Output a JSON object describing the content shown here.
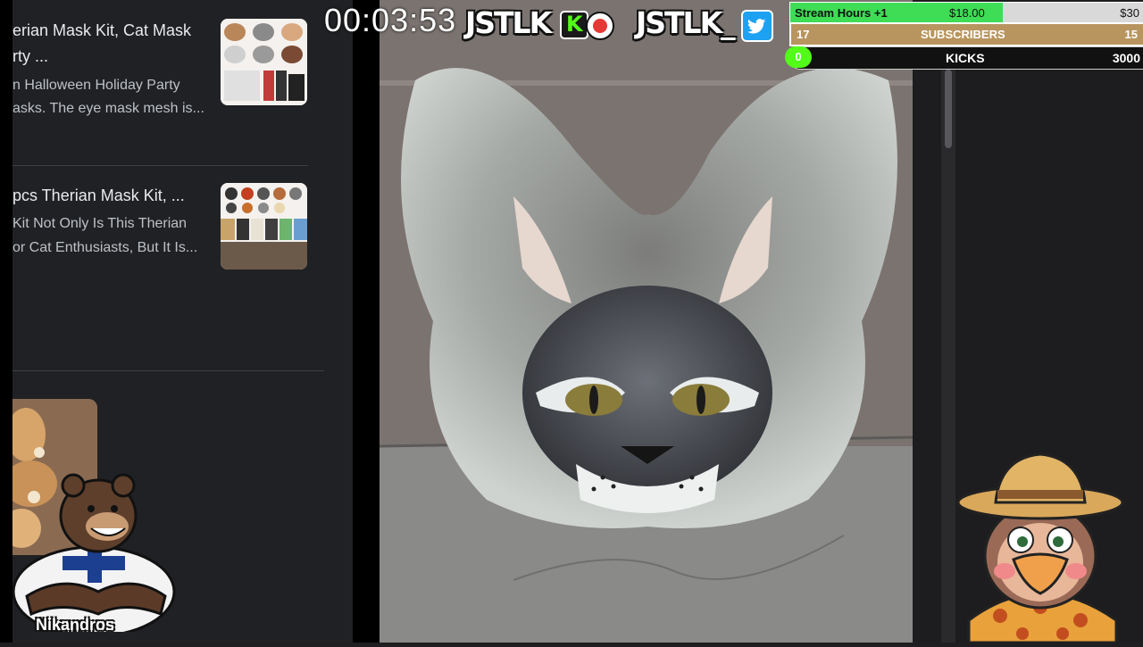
{
  "search_results": [
    {
      "title_line1": "erian Mask Kit, Cat Mask",
      "title_line2": "rty ...",
      "desc_line1": "n Halloween Holiday Party",
      "desc_line2": "asks. The eye mask mesh is..."
    },
    {
      "title_line1": "pcs Therian Mask Kit, ...",
      "desc_line1": "Kit Not Only Is This Therian",
      "desc_line2": "or Cat Enthusiasts, But It Is..."
    }
  ],
  "overlay": {
    "timer": "00:03:53",
    "kick_handle": "JSTLK",
    "kick_letter": "K",
    "twitter_handle": "JSTLK_",
    "streamer_avatar_name": "Nikandros"
  },
  "goals": {
    "stream_hours": {
      "label": "Stream Hours +1",
      "current": "$18.00",
      "target": "$30",
      "progress": 0.6
    },
    "subscribers": {
      "current": "17",
      "label": "SUBSCRIBERS",
      "target": "15",
      "progress": 1.0
    },
    "kicks": {
      "current": "0",
      "label": "KICKS",
      "target": "3000",
      "progress": 0.0
    }
  },
  "colors": {
    "kick_green": "#53fc18",
    "twitter_blue": "#1da1f2",
    "youtube_red": "#e53935",
    "goal_green": "#3fdc55",
    "goal_gold": "#b8955f"
  },
  "icons": [
    "kick-icon",
    "youtube-icon",
    "twitter-icon",
    "bear-avatar",
    "explorer-bird-avatar",
    "cat-mask-photo"
  ]
}
